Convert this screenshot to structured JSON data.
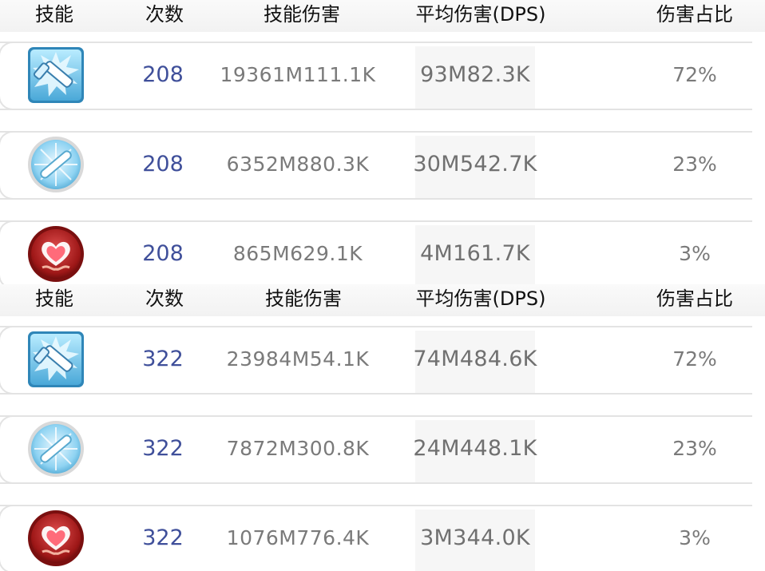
{
  "headers": {
    "skill": "技能",
    "count": "次数",
    "damage": "技能伤害",
    "dps": "平均伤害(DPS)",
    "ratio": "伤害占比"
  },
  "tables": [
    {
      "rows": [
        {
          "icon": "sword-burst-icon",
          "count": "208",
          "damage": "19361M111.1K",
          "dps": "93M82.3K",
          "ratio": "72%"
        },
        {
          "icon": "ice-sword-icon",
          "count": "208",
          "damage": "6352M880.3K",
          "dps": "30M542.7K",
          "ratio": "23%"
        },
        {
          "icon": "heart-icon",
          "count": "208",
          "damage": "865M629.1K",
          "dps": "4M161.7K",
          "ratio": "3%"
        }
      ]
    },
    {
      "rows": [
        {
          "icon": "sword-burst-icon",
          "count": "322",
          "damage": "23984M54.1K",
          "dps": "74M484.6K",
          "ratio": "72%"
        },
        {
          "icon": "ice-sword-icon",
          "count": "322",
          "damage": "7872M300.8K",
          "dps": "24M448.1K",
          "ratio": "23%"
        },
        {
          "icon": "heart-icon",
          "count": "322",
          "damage": "1076M776.4K",
          "dps": "3M344.0K",
          "ratio": "3%"
        }
      ]
    }
  ],
  "colors": {
    "count_text": "#3f4f9a",
    "value_text": "#7a7a7a",
    "header_text": "#111111",
    "row_border": "#e3e3e3"
  }
}
